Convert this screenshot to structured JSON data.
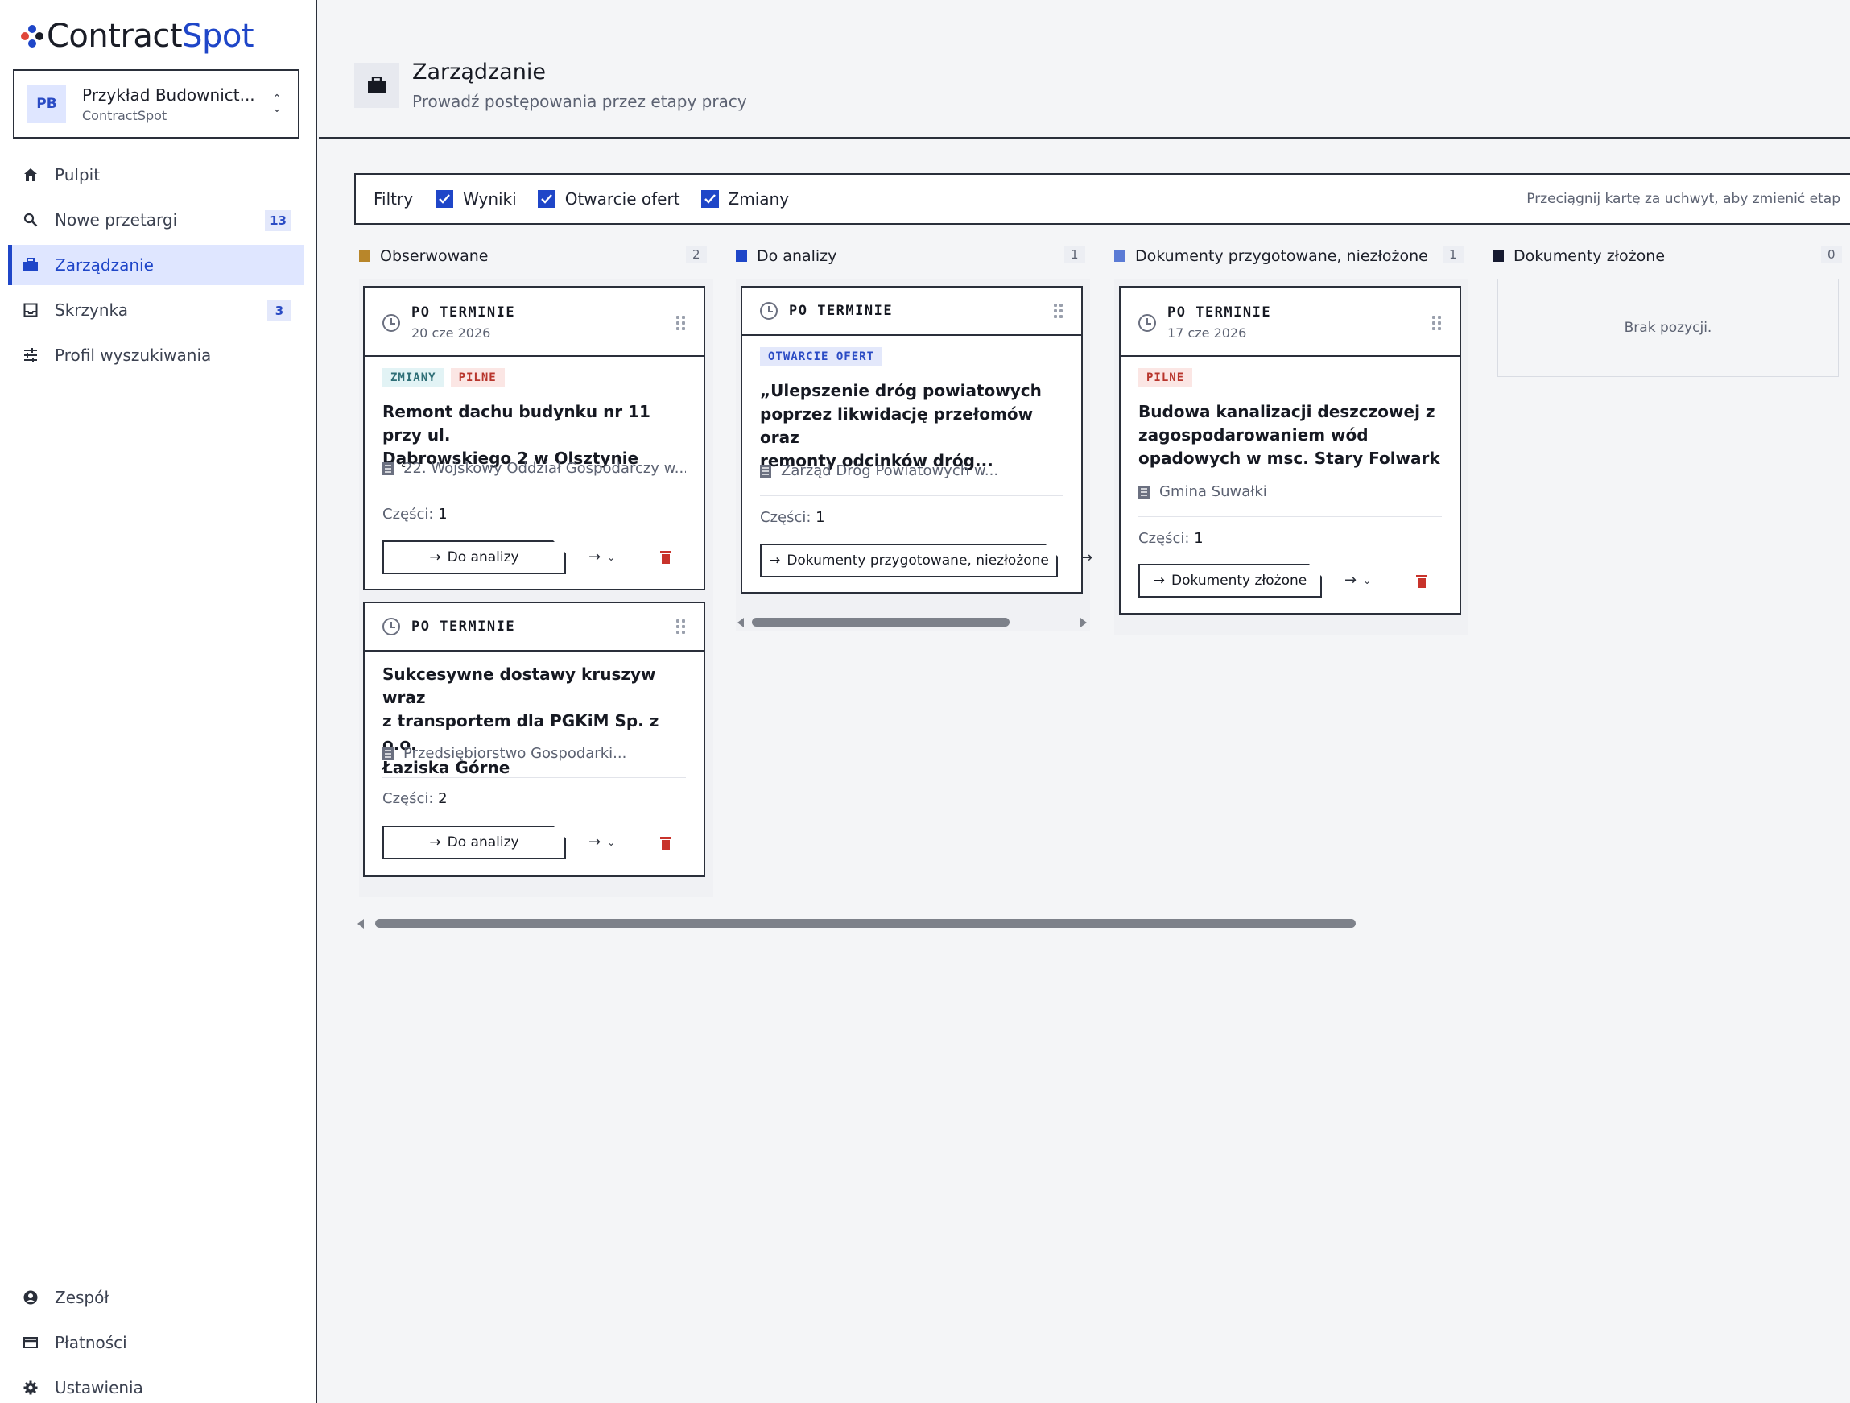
{
  "brand": {
    "name_a": "Contract",
    "name_b": "Spot",
    "colors": {
      "primary": "#1f46c8",
      "dark": "#1a1d27"
    }
  },
  "org": {
    "initials": "PB",
    "name": "Przykład Budownict...",
    "sub": "ContractSpot"
  },
  "nav": {
    "items": [
      {
        "label": "Pulpit",
        "icon": "home-icon"
      },
      {
        "label": "Nowe przetargi",
        "icon": "search-icon",
        "badge": "13"
      },
      {
        "label": "Zarządzanie",
        "icon": "briefcase-icon",
        "active": true
      },
      {
        "label": "Skrzynka",
        "icon": "inbox-icon",
        "badge": "3"
      },
      {
        "label": "Profil wyszukiwania",
        "icon": "sliders-icon"
      }
    ],
    "bottom": [
      {
        "label": "Zespół",
        "icon": "user-circle-icon"
      },
      {
        "label": "Płatności",
        "icon": "credit-card-icon"
      },
      {
        "label": "Ustawienia",
        "icon": "gear-icon"
      }
    ]
  },
  "header": {
    "title": "Zarządzanie",
    "subtitle": "Prowadź postępowania przez etapy pracy"
  },
  "filters": {
    "label": "Filtry",
    "options": [
      {
        "label": "Wyniki",
        "checked": true
      },
      {
        "label": "Otwarcie ofert",
        "checked": true
      },
      {
        "label": "Zmiany",
        "checked": true
      }
    ],
    "hint": "Przeciągnij kartę za uchwyt, aby zmienić etap"
  },
  "columns": [
    {
      "title": "Obserwowane",
      "count": "2",
      "color": "#b8862a",
      "cards": [
        {
          "status": "PO TERMINIE",
          "date": "20 cze 2026",
          "tags": [
            "ZMIANY",
            "PILNE"
          ],
          "title_lines": [
            "Remont dachu budynku nr 11 przy ul.",
            "Dąbrowskiego 2 w Olsztynie"
          ],
          "buyer": "22. Wojskowy Oddział Gospodarczy w...",
          "parts_label": "Części:",
          "parts": "1",
          "move_label": "Do analizy"
        },
        {
          "status": "PO TERMINIE",
          "date": "",
          "tags": [],
          "title_lines": [
            "Sukcesywne dostawy kruszyw wraz",
            "z transportem dla PGKiM Sp. z o.o.",
            "Łaziska Górne"
          ],
          "buyer": "Przedsiębiorstwo Gospodarki...",
          "parts_label": "Części:",
          "parts": "2",
          "move_label": "Do analizy"
        }
      ]
    },
    {
      "title": "Do analizy",
      "count": "1",
      "color": "#1f46c8",
      "cards": [
        {
          "status": "PO TERMINIE",
          "date": "",
          "tags": [
            "OTWARCIE OFERT"
          ],
          "title_lines": [
            "„Ulepszenie dróg powiatowych",
            "poprzez likwidację przełomów oraz",
            "remonty odcinków dróg..."
          ],
          "buyer": "Zarząd Dróg Powiatowych w...",
          "parts_label": "Części:",
          "parts": "1",
          "move_label": "Dokumenty przygotowane, niezłożone"
        }
      ]
    },
    {
      "title": "Dokumenty przygotowane, niezłożone",
      "count": "1",
      "color": "#5b7bd5",
      "cards": [
        {
          "status": "PO TERMINIE",
          "date": "17 cze 2026",
          "tags": [
            "PILNE"
          ],
          "title_lines": [
            "Budowa kanalizacji deszczowej z",
            "zagospodarowaniem wód",
            "opadowych w msc. Stary Folwark"
          ],
          "buyer": "Gmina Suwałki",
          "parts_label": "Części:",
          "parts": "1",
          "move_label": "Dokumenty złożone"
        }
      ]
    },
    {
      "title": "Dokumenty złożone",
      "count": "0",
      "color": "#161a30",
      "empty": "Brak pozycji."
    }
  ]
}
